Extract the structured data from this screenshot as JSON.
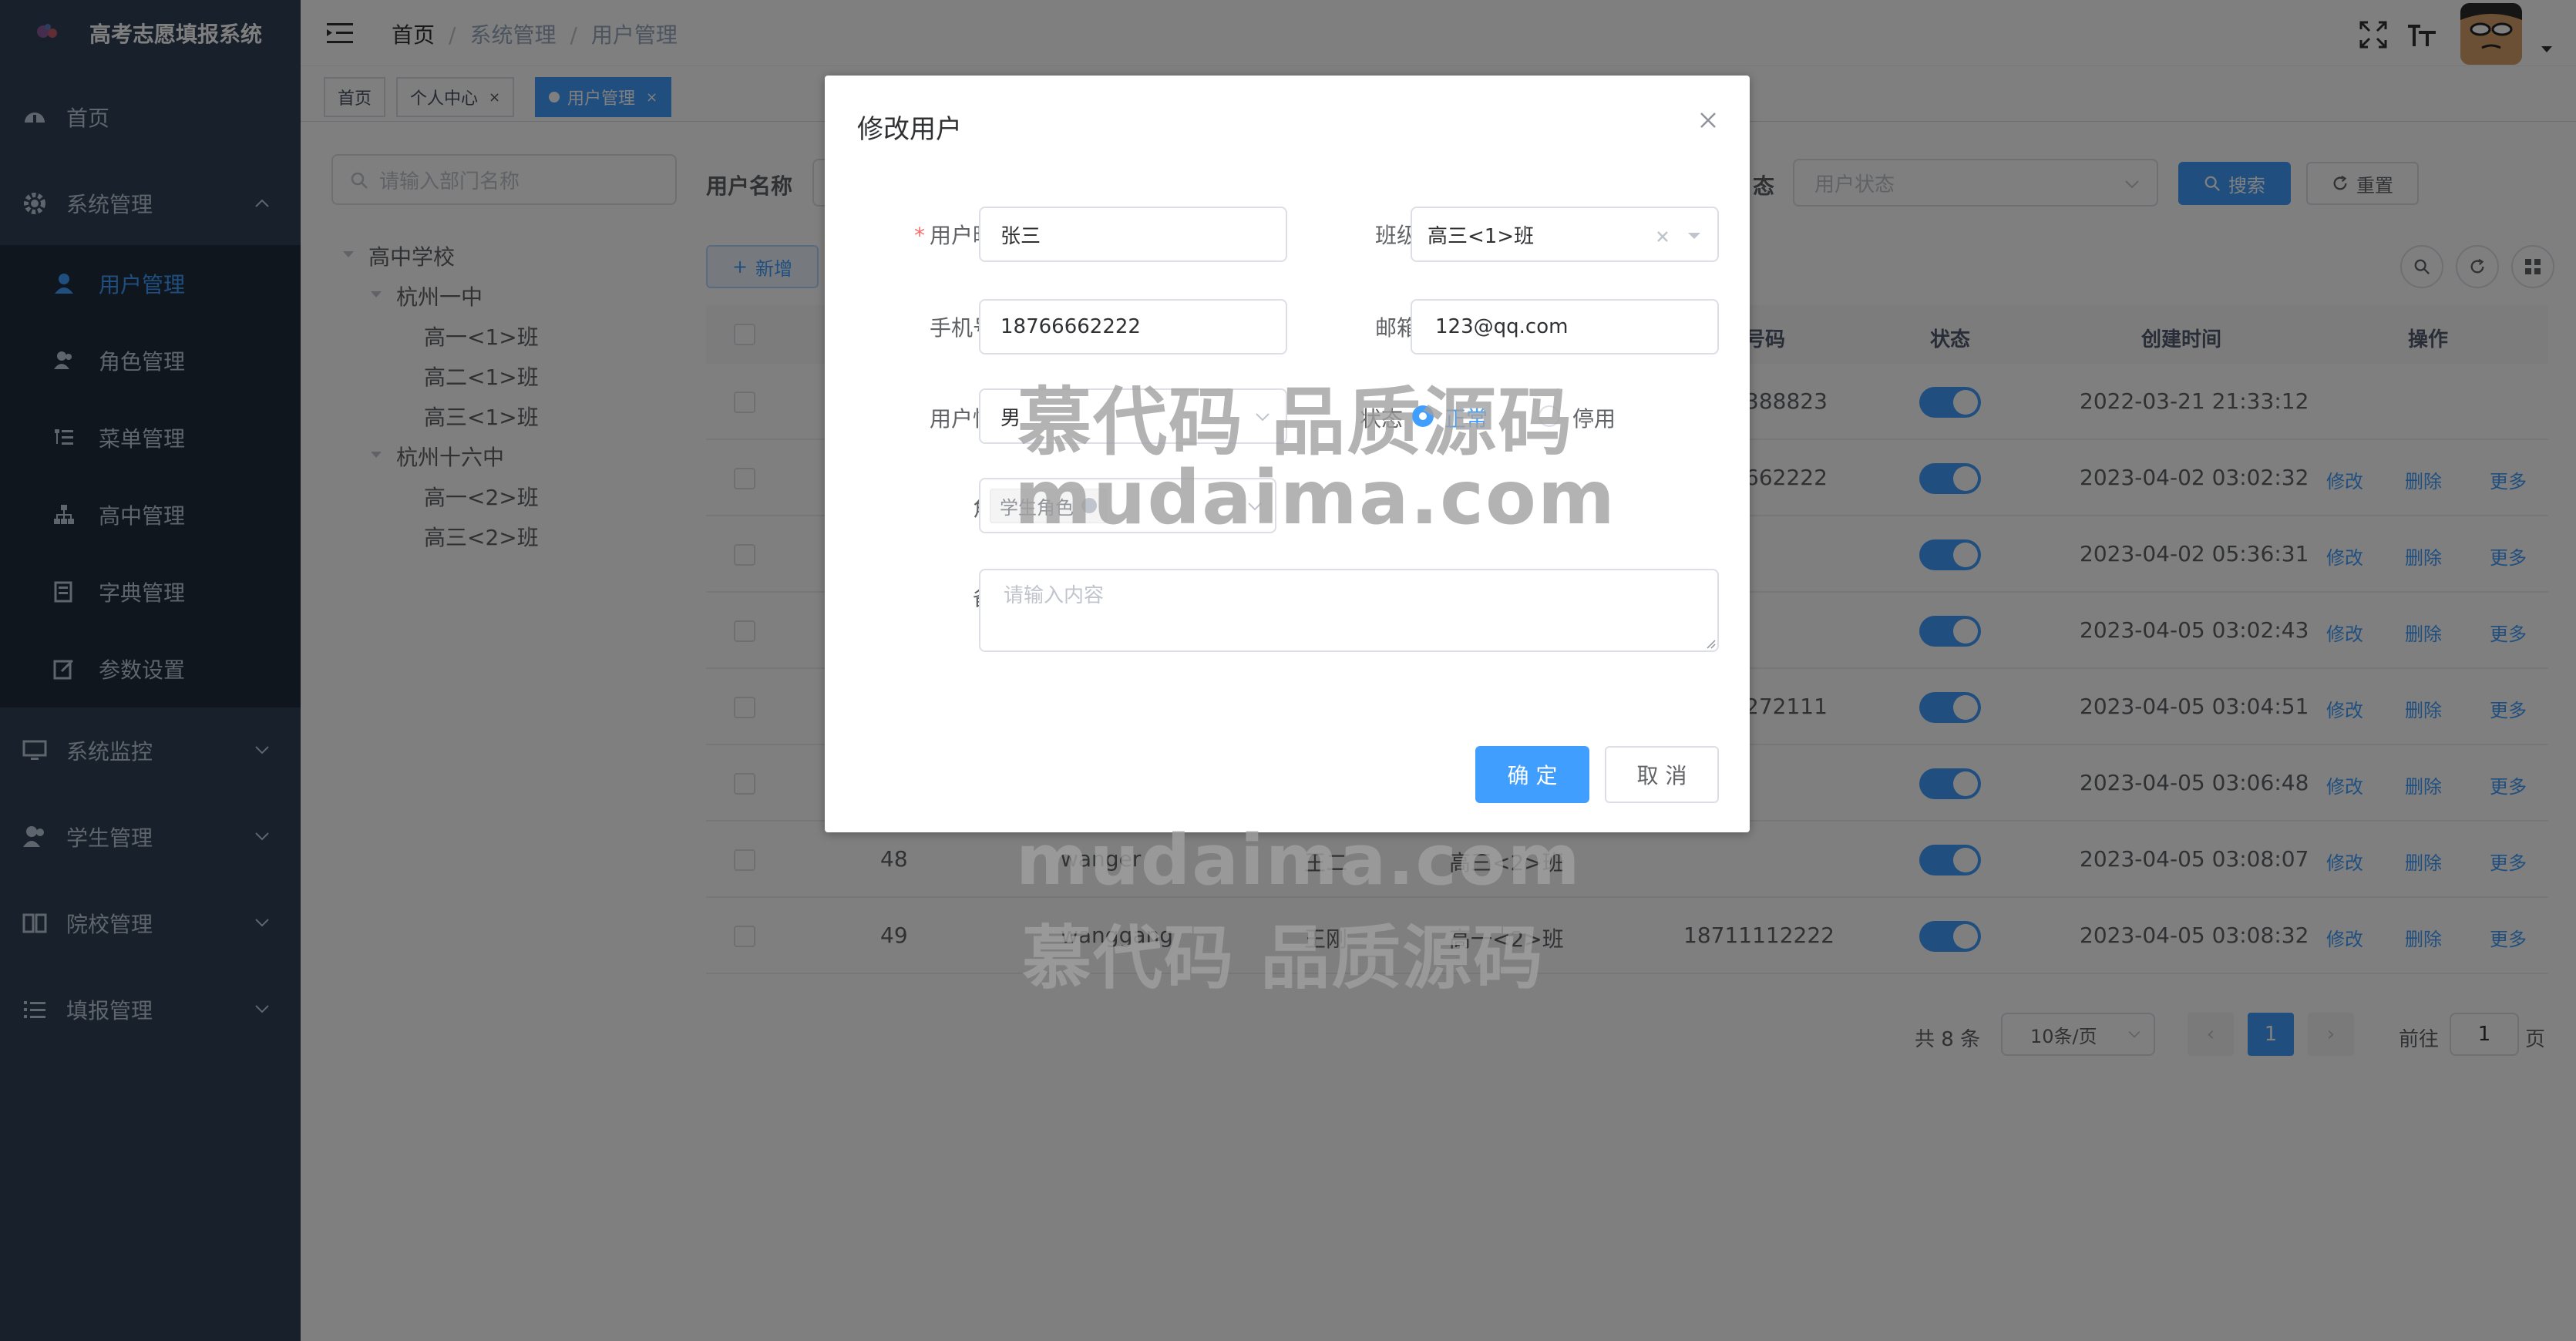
{
  "app": {
    "title": "高考志愿填报系统"
  },
  "sidebar": {
    "home": "首页",
    "system": "系统管理",
    "sub_items": [
      "用户管理",
      "角色管理",
      "菜单管理",
      "高中管理",
      "字典管理",
      "参数设置"
    ],
    "active_sub": "用户管理",
    "monitor": "系统监控",
    "student": "学生管理",
    "college": "院校管理",
    "report": "填报管理"
  },
  "breadcrumb": [
    "首页",
    "系统管理",
    "用户管理"
  ],
  "tags": [
    {
      "label": "首页",
      "closable": false
    },
    {
      "label": "个人中心",
      "closable": true
    },
    {
      "label": "用户管理",
      "closable": true,
      "active": true
    }
  ],
  "tree": {
    "search_placeholder": "请输入部门名称",
    "root": "高中学校",
    "school1": "杭州一中",
    "s1_classes": [
      "高一<1>班",
      "高二<1>班",
      "高三<1>班"
    ],
    "school2": "杭州十六中",
    "s2_classes": [
      "高一<2>班",
      "高三<2>班"
    ]
  },
  "filters": {
    "username_label": "用户名称",
    "status_label_tail": "态",
    "status_placeholder": "用户状态",
    "search_button": "搜索",
    "reset_button": "重置",
    "add_button": "新增"
  },
  "table": {
    "headers": {
      "phone_tail": "号码",
      "status": "状态",
      "created": "创建时间",
      "action": "操作"
    },
    "rows": [
      {
        "id": "",
        "username": "",
        "nickname": "",
        "dept": "",
        "phone": "388823",
        "status": true,
        "created": "2022-03-21 21:33:12",
        "ops": false
      },
      {
        "id": "",
        "username": "",
        "nickname": "",
        "dept": "",
        "phone": "662222",
        "status": true,
        "created": "2023-04-02 03:02:32",
        "ops": true
      },
      {
        "id": "",
        "username": "",
        "nickname": "",
        "dept": "",
        "phone": "",
        "status": true,
        "created": "2023-04-02 05:36:31",
        "ops": true
      },
      {
        "id": "",
        "username": "",
        "nickname": "",
        "dept": "",
        "phone": "",
        "status": true,
        "created": "2023-04-05 03:02:43",
        "ops": true
      },
      {
        "id": "",
        "username": "",
        "nickname": "",
        "dept": "",
        "phone": "272111",
        "status": true,
        "created": "2023-04-05 03:04:51",
        "ops": true
      },
      {
        "id": "",
        "username": "",
        "nickname": "",
        "dept": "",
        "phone": "",
        "status": true,
        "created": "2023-04-05 03:06:48",
        "ops": true
      },
      {
        "id": "48",
        "username": "wanger",
        "nickname": "王二",
        "dept": "高三<2>班",
        "phone": "",
        "status": true,
        "created": "2023-04-05 03:08:07",
        "ops": true
      },
      {
        "id": "49",
        "username": "wanggang",
        "nickname": "王刚",
        "dept": "高一<2>班",
        "phone": "18711112222",
        "status": true,
        "created": "2023-04-05 03:08:32",
        "ops": true
      }
    ],
    "op_edit": "修改",
    "op_delete": "删除",
    "op_more": "更多"
  },
  "pagination": {
    "total_text": "共 8 条",
    "page_size": "10条/页",
    "current": "1",
    "goto_label": "前往",
    "goto_value": "1",
    "page_unit": "页"
  },
  "dialog": {
    "title": "修改用户",
    "fields": {
      "nickname_label": "用户昵称",
      "nickname_value": "张三",
      "class_label": "班级",
      "class_value": "高三<1>班",
      "phone_label": "手机号码",
      "phone_value": "18766662222",
      "email_label": "邮箱",
      "email_value": "123@qq.com",
      "gender_label": "用户性别",
      "gender_value": "男",
      "status_label": "状态",
      "status_normal": "正常",
      "status_disabled": "停用",
      "role_label": "角色",
      "role_tag": "学生角色",
      "remark_label": "备注",
      "remark_placeholder": "请输入内容"
    },
    "confirm": "确 定",
    "cancel": "取 消"
  },
  "watermark": {
    "cn": "慕代码 品质源码",
    "en": "mudaima.com"
  },
  "colors": {
    "primary": "#409eff",
    "sidebar": "#304156",
    "submenu": "#1f2d3d"
  }
}
